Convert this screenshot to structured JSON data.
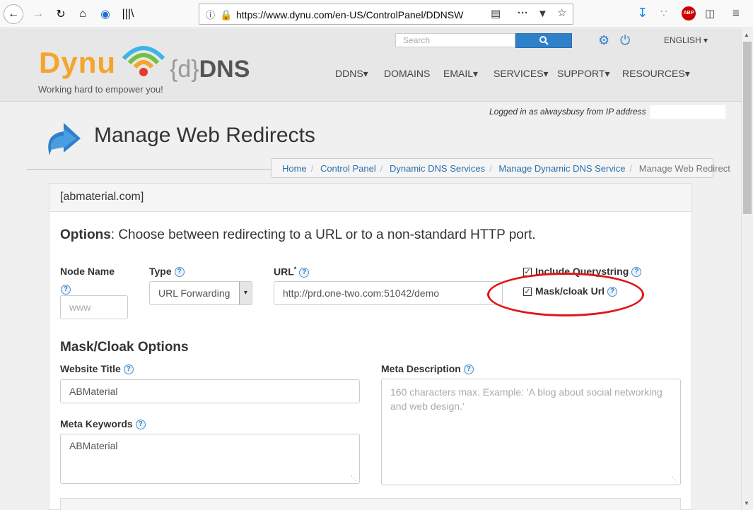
{
  "browser": {
    "url_main": "https://www.dynu.com/en-US/ControlPanel/DDNSW",
    "url_fade": "..."
  },
  "header": {
    "logo_text": "Dynu",
    "logo_sub_open": "{d}",
    "logo_sub": "DNS",
    "tagline": "Working hard to empower you!",
    "search_placeholder": "Search",
    "language": "ENGLISH",
    "nav": [
      "DDNS",
      "DOMAINS",
      "EMAIL",
      "SERVICES",
      "SUPPORT",
      "RESOURCES"
    ]
  },
  "page": {
    "logged_in": "Logged in as alwaysbusy from IP address",
    "title": "Manage Web Redirects",
    "breadcrumb": [
      "Home",
      "Control Panel",
      "Dynamic DNS Services",
      "Manage Dynamic DNS Service"
    ],
    "breadcrumb_current": "Manage Web Redirect"
  },
  "panel": {
    "heading": "[abmaterial.com]",
    "options_bold": "Options",
    "options_text": ": Choose between redirecting to a URL or to a non-standard HTTP port.",
    "node_name_label": "Node Name",
    "node_name_placeholder": "www",
    "type_label": "Type",
    "type_value": "URL Forwarding",
    "url_label": "URL",
    "url_star": "*",
    "url_value": "http://prd.one-two.com:51042/demo",
    "include_qs_label": "Include Querystring",
    "mask_label": "Mask/cloak Url",
    "mask_section_title": "Mask/Cloak Options",
    "website_title_label": "Website Title",
    "website_title_value": "ABMaterial",
    "meta_desc_label": "Meta Description",
    "meta_desc_placeholder": "160 characters max. Example: 'A blog about social networking and web design.'",
    "meta_kw_label": "Meta Keywords",
    "meta_kw_value": "ABMaterial"
  }
}
